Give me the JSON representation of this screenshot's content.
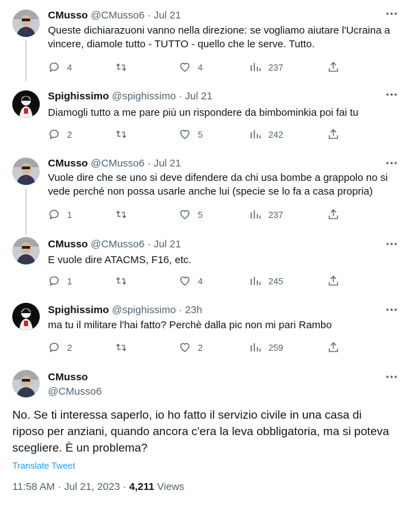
{
  "colors": {
    "text": "#0f1419",
    "muted": "#536471",
    "link": "#1d9bf0",
    "line": "#cfd9de",
    "divider": "#eff3f4"
  },
  "tweets": [
    {
      "name": "CMusso",
      "handle": "@CMusso6",
      "time": "· Jul 21",
      "text": "Queste dichiarazuoni vanno nella direzione: se vogliamo aiutare l'Ucraina a vincere, diamole tutto - TUTTO - quello che le serve. Tutto.",
      "replies": "4",
      "retweets": "",
      "likes": "4",
      "views": "237"
    },
    {
      "name": "Spighissimo",
      "handle": "@spighissimo",
      "time": "· Jul 21",
      "text": "Diamogli tutto a me pare più un rispondere da bimbominkia poi fai tu",
      "replies": "2",
      "retweets": "",
      "likes": "5",
      "views": "242"
    },
    {
      "name": "CMusso",
      "handle": "@CMusso6",
      "time": "· Jul 21",
      "text": "Vuole dire che se uno si deve difendere da chi usa bombe a grappolo no  si vede perché non possa usarle anche lui (specie se lo fa a casa propria)",
      "replies": "1",
      "retweets": "",
      "likes": "5",
      "views": "237"
    },
    {
      "name": "CMusso",
      "handle": "@CMusso6",
      "time": "· Jul 21",
      "text": "E vuole dire ATACMS, F16, etc.",
      "replies": "1",
      "retweets": "",
      "likes": "4",
      "views": "245"
    },
    {
      "name": "Spighissimo",
      "handle": "@spighissimo",
      "time": "· 23h",
      "text": "ma tu il militare l'hai fatto? Perchè dalla pic non mi pari Rambo",
      "replies": "2",
      "retweets": "",
      "likes": "2",
      "views": "259"
    }
  ],
  "main": {
    "name": "CMusso",
    "handle": "@CMusso6",
    "text": "No. Se ti interessa saperlo, io ho fatto il servizio civile in una casa di riposo per anziani, quando ancora c'era la leva obbligatoria, ma si poteva scegliere. È un problema?",
    "translate": "Translate Tweet",
    "timestamp": "11:58 AM · Jul 21, 2023 · ",
    "views_count": "4,211",
    "views_label": " Views"
  }
}
